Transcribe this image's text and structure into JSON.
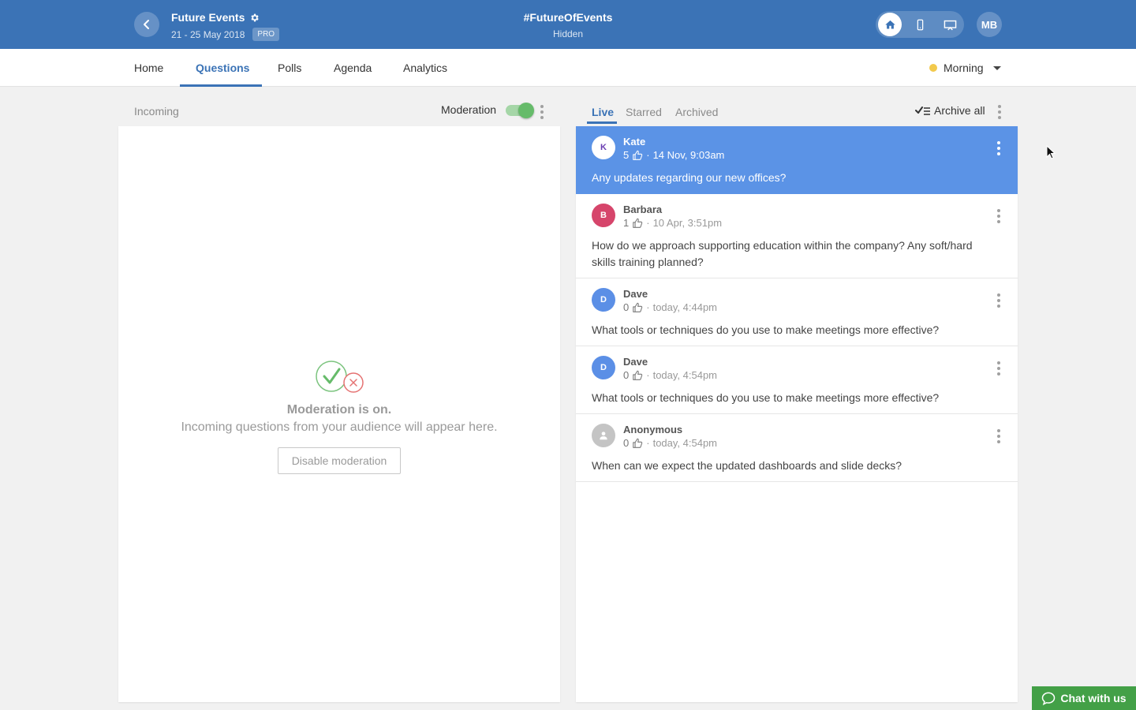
{
  "header": {
    "event_title": "Future Events",
    "event_dates": "21 - 25 May 2018",
    "plan_badge": "PRO",
    "hashtag": "#FutureOfEvents",
    "visibility": "Hidden",
    "user_initials": "MB",
    "modes": [
      {
        "icon": "home-icon",
        "active": true
      },
      {
        "icon": "mobile-icon",
        "active": false
      },
      {
        "icon": "presentation-icon",
        "active": false
      }
    ]
  },
  "nav": {
    "tabs": [
      "Home",
      "Questions",
      "Polls",
      "Agenda",
      "Analytics"
    ],
    "active_tab": "Questions",
    "session": "Morning",
    "session_color": "#f2c94c"
  },
  "incoming": {
    "label": "Incoming",
    "moderation_label": "Moderation",
    "moderation_on": true,
    "empty_title": "Moderation is on.",
    "empty_subtitle": "Incoming questions from your audience will appear here.",
    "disable_button": "Disable moderation"
  },
  "questions": {
    "tabs": [
      "Live",
      "Starred",
      "Archived"
    ],
    "active_tab": "Live",
    "archive_all_label": "Archive all",
    "items": [
      {
        "initial": "K",
        "name": "Kate",
        "likes": "5",
        "time": "14 Nov, 9:03am",
        "text": "Any updates regarding our new offices?",
        "avatar_color": "#ffffff",
        "selected": true
      },
      {
        "initial": "B",
        "name": "Barbara",
        "likes": "1",
        "time": "10 Apr, 3:51pm",
        "text": "How do we approach supporting education within the company? Any soft/hard skills training planned?",
        "avatar_color": "#d6456b",
        "selected": false
      },
      {
        "initial": "D",
        "name": "Dave",
        "likes": "0",
        "time": "today, 4:44pm",
        "text": "What tools or techniques do you use to make meetings more effective?",
        "avatar_color": "#5b8fe6",
        "selected": false
      },
      {
        "initial": "D",
        "name": "Dave",
        "likes": "0",
        "time": "today, 4:54pm",
        "text": "What tools or techniques do you use to make meetings more effective?",
        "avatar_color": "#5b8fe6",
        "selected": false
      },
      {
        "initial": "",
        "name": "Anonymous",
        "likes": "0",
        "time": "today, 4:54pm",
        "text": "When can we expect the updated dashboards and slide decks?",
        "avatar_color": "#c4c4c4",
        "selected": false
      }
    ]
  },
  "chat": {
    "label": "Chat with us"
  },
  "colors": {
    "brand": "#3b73b6",
    "selected_row": "#5b93e6",
    "toggle_on": "#66bb6a",
    "chat": "#43a047"
  }
}
